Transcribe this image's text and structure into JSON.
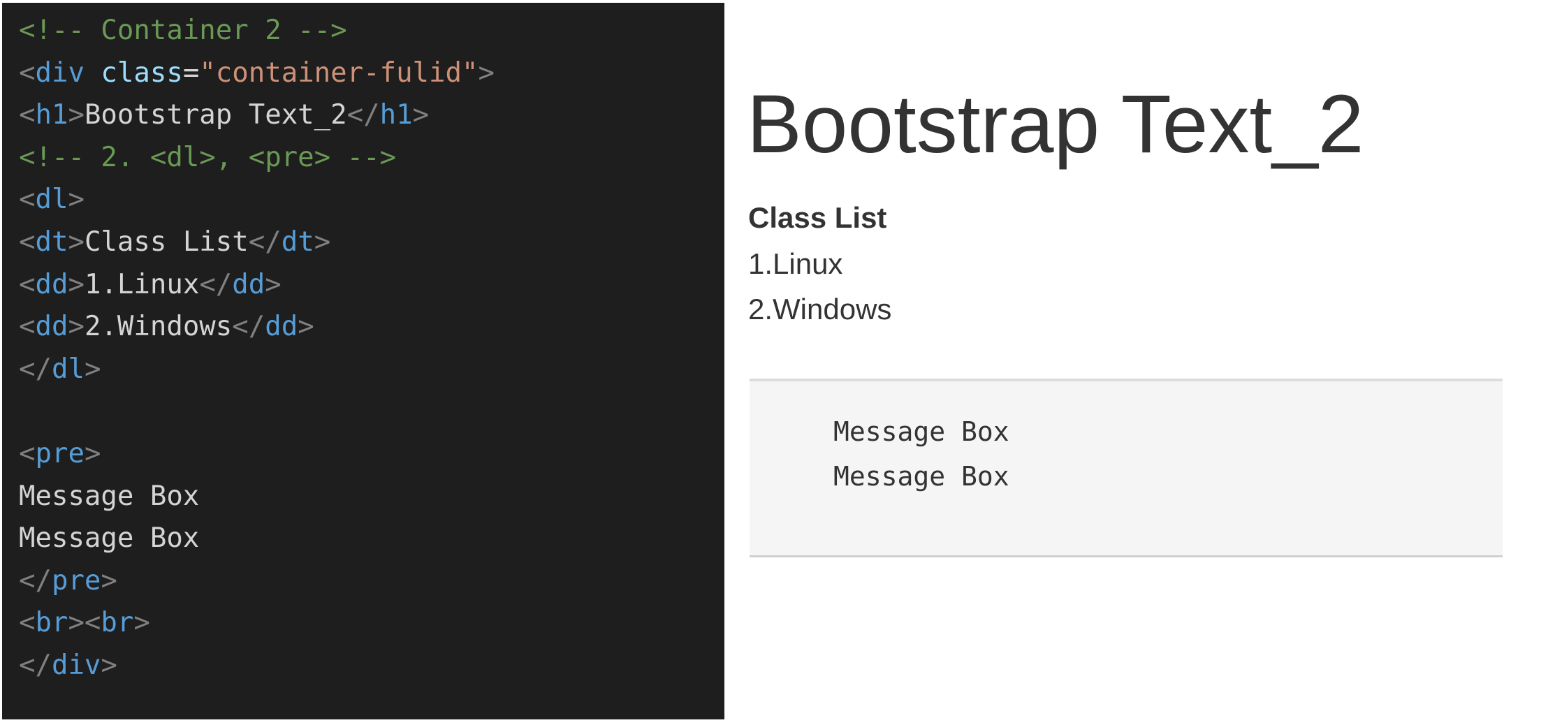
{
  "code_editor": {
    "lines": [
      [
        {
          "t": "c",
          "v": "<!-- Container 2 -->"
        }
      ],
      [
        {
          "t": "p",
          "v": "<"
        },
        {
          "t": "g",
          "v": "div"
        },
        {
          "t": "x",
          "v": " "
        },
        {
          "t": "a",
          "v": "class"
        },
        {
          "t": "x",
          "v": "="
        },
        {
          "t": "s",
          "v": "\"container-fulid\""
        },
        {
          "t": "p",
          "v": ">"
        }
      ],
      [
        {
          "t": "p",
          "v": "<"
        },
        {
          "t": "g",
          "v": "h1"
        },
        {
          "t": "p",
          "v": ">"
        },
        {
          "t": "x",
          "v": "Bootstrap Text_2"
        },
        {
          "t": "p",
          "v": "</"
        },
        {
          "t": "g",
          "v": "h1"
        },
        {
          "t": "p",
          "v": ">"
        }
      ],
      [
        {
          "t": "c",
          "v": "<!-- 2. <dl>, <pre> -->"
        }
      ],
      [
        {
          "t": "p",
          "v": "<"
        },
        {
          "t": "g",
          "v": "dl"
        },
        {
          "t": "p",
          "v": ">"
        }
      ],
      [
        {
          "t": "p",
          "v": "<"
        },
        {
          "t": "g",
          "v": "dt"
        },
        {
          "t": "p",
          "v": ">"
        },
        {
          "t": "x",
          "v": "Class List"
        },
        {
          "t": "p",
          "v": "</"
        },
        {
          "t": "g",
          "v": "dt"
        },
        {
          "t": "p",
          "v": ">"
        }
      ],
      [
        {
          "t": "p",
          "v": "<"
        },
        {
          "t": "g",
          "v": "dd"
        },
        {
          "t": "p",
          "v": ">"
        },
        {
          "t": "x",
          "v": "1.Linux"
        },
        {
          "t": "p",
          "v": "</"
        },
        {
          "t": "g",
          "v": "dd"
        },
        {
          "t": "p",
          "v": ">"
        }
      ],
      [
        {
          "t": "p",
          "v": "<"
        },
        {
          "t": "g",
          "v": "dd"
        },
        {
          "t": "p",
          "v": ">"
        },
        {
          "t": "x",
          "v": "2.Windows"
        },
        {
          "t": "p",
          "v": "</"
        },
        {
          "t": "g",
          "v": "dd"
        },
        {
          "t": "p",
          "v": ">"
        }
      ],
      [
        {
          "t": "p",
          "v": "</"
        },
        {
          "t": "g",
          "v": "dl"
        },
        {
          "t": "p",
          "v": ">"
        }
      ],
      [],
      [
        {
          "t": "p",
          "v": "<"
        },
        {
          "t": "g",
          "v": "pre"
        },
        {
          "t": "p",
          "v": ">"
        }
      ],
      [
        {
          "t": "x",
          "v": "Message Box"
        }
      ],
      [
        {
          "t": "x",
          "v": "Message Box"
        }
      ],
      [
        {
          "t": "p",
          "v": "</"
        },
        {
          "t": "g",
          "v": "pre"
        },
        {
          "t": "p",
          "v": ">"
        }
      ],
      [
        {
          "t": "p",
          "v": "<"
        },
        {
          "t": "g",
          "v": "br"
        },
        {
          "t": "p",
          "v": "><"
        },
        {
          "t": "g",
          "v": "br"
        },
        {
          "t": "p",
          "v": ">"
        }
      ],
      [
        {
          "t": "p",
          "v": "</"
        },
        {
          "t": "g",
          "v": "div"
        },
        {
          "t": "p",
          "v": ">"
        }
      ]
    ]
  },
  "preview": {
    "heading": "Bootstrap Text_2",
    "definition_term": "Class List",
    "definitions": [
      "1.Linux",
      "2.Windows"
    ],
    "pre_lines": [
      "Message Box",
      "Message Box"
    ]
  },
  "colors": {
    "editor_background": "#1e1e1e",
    "comment": "#6a9955",
    "tag": "#569cd6",
    "attribute": "#9cdcfe",
    "string": "#ce9178",
    "punctuation": "#808080",
    "text": "#d4d4d4",
    "preview_text": "#333333",
    "pre_background": "#f5f5f5"
  }
}
